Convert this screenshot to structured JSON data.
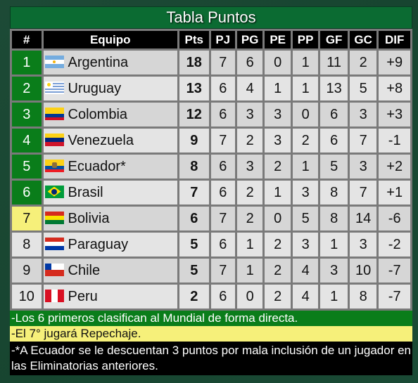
{
  "title": "Tabla Puntos",
  "columns": [
    "#",
    "Equipo",
    "Pts",
    "PJ",
    "PG",
    "PE",
    "PP",
    "GF",
    "GC",
    "DIF"
  ],
  "rows": [
    {
      "pos": "1",
      "team": "Argentina",
      "flag": "argentina-flag",
      "zone": "green",
      "pts": "18",
      "pj": "7",
      "pg": "6",
      "pe": "0",
      "pp": "1",
      "gf": "11",
      "gc": "2",
      "dif": "+9"
    },
    {
      "pos": "2",
      "team": "Uruguay",
      "flag": "uruguay-flag",
      "zone": "green",
      "pts": "13",
      "pj": "6",
      "pg": "4",
      "pe": "1",
      "pp": "1",
      "gf": "13",
      "gc": "5",
      "dif": "+8"
    },
    {
      "pos": "3",
      "team": "Colombia",
      "flag": "colombia-flag",
      "zone": "green",
      "pts": "12",
      "pj": "6",
      "pg": "3",
      "pe": "3",
      "pp": "0",
      "gf": "6",
      "gc": "3",
      "dif": "+3"
    },
    {
      "pos": "4",
      "team": "Venezuela",
      "flag": "venezuela-flag",
      "zone": "green",
      "pts": "9",
      "pj": "7",
      "pg": "2",
      "pe": "3",
      "pp": "2",
      "gf": "6",
      "gc": "7",
      "dif": "-1"
    },
    {
      "pos": "5",
      "team": "Ecuador*",
      "flag": "ecuador-flag",
      "zone": "green",
      "pts": "8",
      "pj": "6",
      "pg": "3",
      "pe": "2",
      "pp": "1",
      "gf": "5",
      "gc": "3",
      "dif": "+2"
    },
    {
      "pos": "6",
      "team": "Brasil",
      "flag": "brasil-flag",
      "zone": "green",
      "pts": "7",
      "pj": "6",
      "pg": "2",
      "pe": "1",
      "pp": "3",
      "gf": "8",
      "gc": "7",
      "dif": "+1"
    },
    {
      "pos": "7",
      "team": "Bolivia",
      "flag": "bolivia-flag",
      "zone": "yellow",
      "pts": "6",
      "pj": "7",
      "pg": "2",
      "pe": "0",
      "pp": "5",
      "gf": "8",
      "gc": "14",
      "dif": "-6"
    },
    {
      "pos": "8",
      "team": "Paraguay",
      "flag": "paraguay-flag",
      "zone": "none",
      "pts": "5",
      "pj": "6",
      "pg": "1",
      "pe": "2",
      "pp": "3",
      "gf": "1",
      "gc": "3",
      "dif": "-2"
    },
    {
      "pos": "9",
      "team": "Chile",
      "flag": "chile-flag",
      "zone": "none",
      "pts": "5",
      "pj": "7",
      "pg": "1",
      "pe": "2",
      "pp": "4",
      "gf": "3",
      "gc": "10",
      "dif": "-7"
    },
    {
      "pos": "10",
      "team": "Peru",
      "flag": "peru-flag",
      "zone": "none",
      "pts": "2",
      "pj": "6",
      "pg": "0",
      "pe": "2",
      "pp": "4",
      "gf": "1",
      "gc": "8",
      "dif": "-7"
    }
  ],
  "notes": {
    "direct": "-Los 6 primeros clasifican al Mundial de forma directa.",
    "repechaje": "-El 7° jugará Repechaje.",
    "ecuador": "-*A Ecuador se le descuentan 3 puntos por mala inclusión de un jugador en las Eliminatorias anteriores."
  },
  "colors": {
    "direct_zone": "#0a7d1a",
    "repechaje_zone": "#f6f07a",
    "header_bg": "#000000",
    "title_bg": "#0b6b32"
  }
}
